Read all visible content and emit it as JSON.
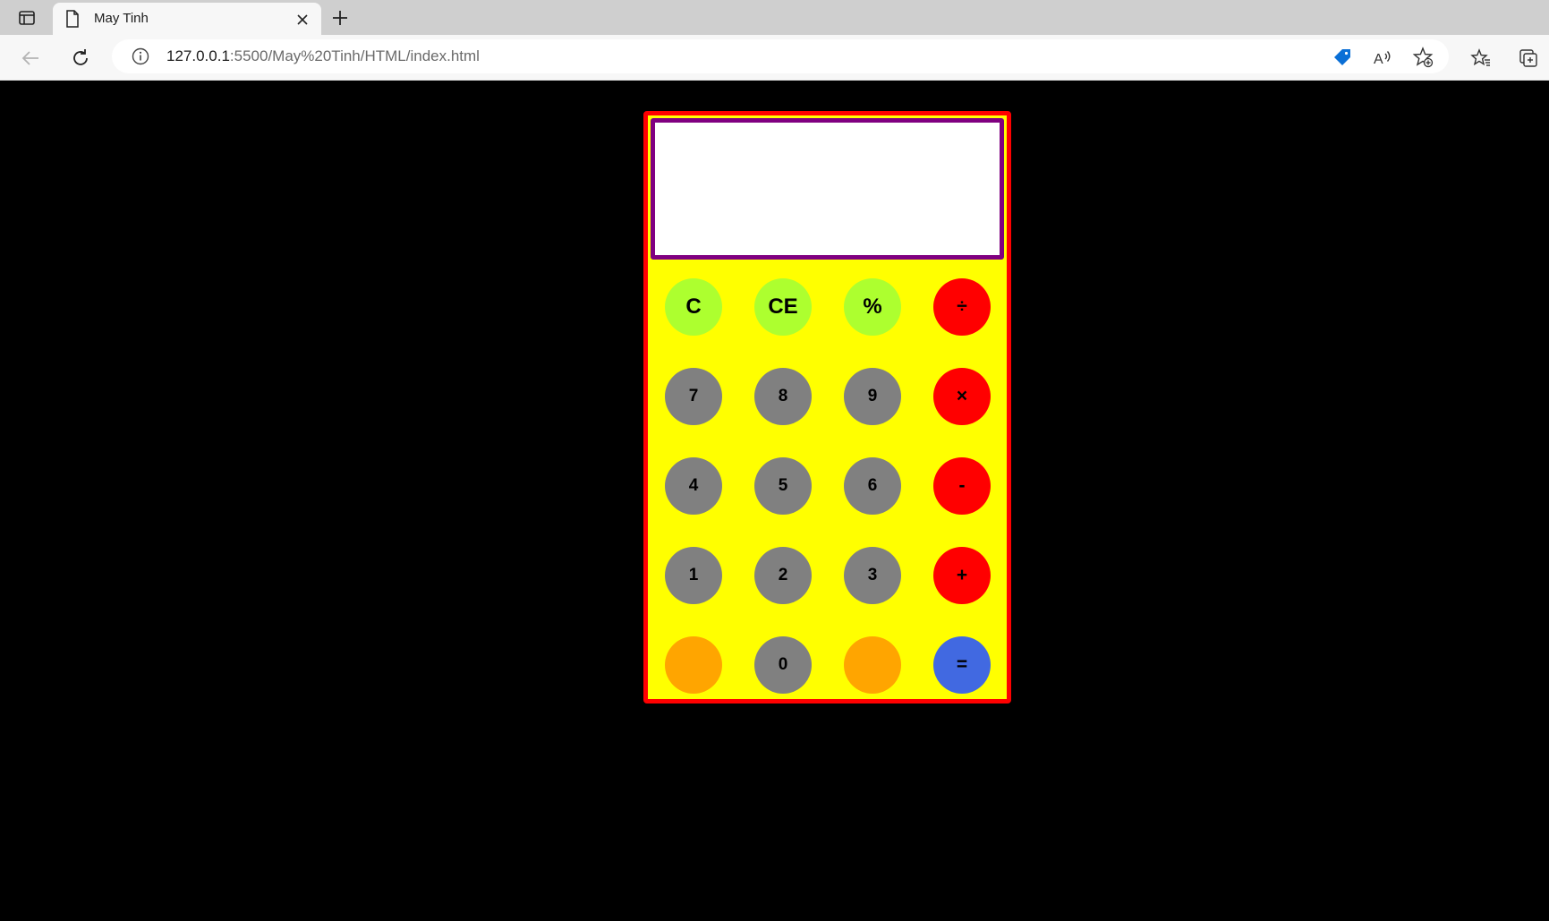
{
  "browser": {
    "tab": {
      "title": "May Tinh"
    },
    "address": {
      "host": "127.0.0.1",
      "path": ":5500/May%20Tinh/HTML/index.html"
    }
  },
  "calculator": {
    "display_value": "",
    "colors": {
      "frame_border": "#ff0000",
      "body": "#ffff00",
      "display_border": "#800080",
      "function_key": "#adff2f",
      "number_key": "#808080",
      "operator_key": "#ff0000",
      "blank_key": "#ffa500",
      "equals_key": "#4169e1"
    },
    "keys": {
      "clear": "C",
      "clear_entry": "CE",
      "percent": "%",
      "divide": "÷",
      "seven": "7",
      "eight": "8",
      "nine": "9",
      "multiply": "×",
      "four": "4",
      "five": "5",
      "six": "6",
      "subtract": "-",
      "one": "1",
      "two": "2",
      "three": "3",
      "add": "+",
      "blank_left": "",
      "zero": "0",
      "blank_right": "",
      "equals": "="
    }
  }
}
